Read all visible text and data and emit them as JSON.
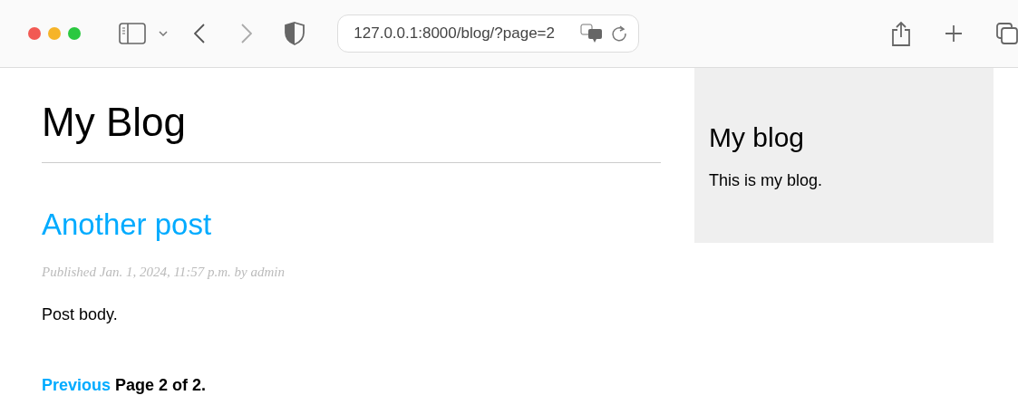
{
  "browser": {
    "url": "127.0.0.1:8000/blog/?page=2"
  },
  "page": {
    "title": "My Blog",
    "posts": [
      {
        "title": "Another post",
        "meta": "Published Jan. 1, 2024, 11:57 p.m. by admin",
        "body": "Post body."
      }
    ],
    "pagination": {
      "previous": "Previous",
      "current": "Page 2 of 2."
    }
  },
  "sidebar": {
    "title": "My blog",
    "text": "This is my blog."
  }
}
